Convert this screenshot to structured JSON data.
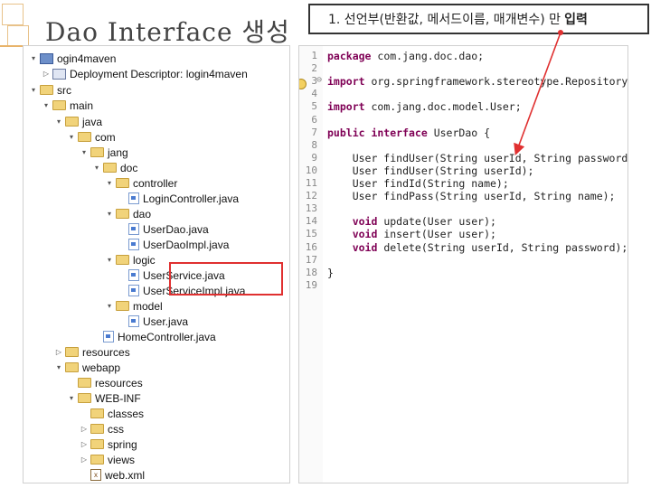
{
  "slide": {
    "title": "Dao Interface 생성",
    "callout_text": "1. 선언부(반환값, 메서드이름, 매개변수) 만",
    "callout_bold": "입력"
  },
  "tree": {
    "items": [
      {
        "label": "ogin4maven",
        "icon": "project-icon",
        "expand": "▾"
      },
      {
        "label": "Deployment Descriptor: login4maven",
        "icon": "descriptor-icon",
        "expand": "▷"
      },
      {
        "label": "src",
        "icon": "folder-icon",
        "expand": "▾"
      },
      {
        "label": "main",
        "icon": "folder-icon",
        "expand": "▾"
      },
      {
        "label": "java",
        "icon": "folder-icon",
        "expand": "▾"
      },
      {
        "label": "com",
        "icon": "folder-icon",
        "expand": "▾"
      },
      {
        "label": "jang",
        "icon": "folder-icon",
        "expand": "▾"
      },
      {
        "label": "doc",
        "icon": "folder-icon",
        "expand": "▾"
      },
      {
        "label": "controller",
        "icon": "folder-icon",
        "expand": "▾"
      },
      {
        "label": "LoginController.java",
        "icon": "java-file-icon",
        "expand": ""
      },
      {
        "label": "dao",
        "icon": "folder-icon",
        "expand": "▾"
      },
      {
        "label": "UserDao.java",
        "icon": "java-file-icon",
        "expand": ""
      },
      {
        "label": "UserDaoImpl.java",
        "icon": "java-file-icon",
        "expand": ""
      },
      {
        "label": "logic",
        "icon": "folder-icon",
        "expand": "▾"
      },
      {
        "label": "UserService.java",
        "icon": "java-file-icon",
        "expand": ""
      },
      {
        "label": "UserServiceImpl.java",
        "icon": "java-file-icon",
        "expand": ""
      },
      {
        "label": "model",
        "icon": "folder-icon",
        "expand": "▾"
      },
      {
        "label": "User.java",
        "icon": "java-file-icon",
        "expand": ""
      },
      {
        "label": "HomeController.java",
        "icon": "java-file-icon",
        "expand": ""
      },
      {
        "label": "resources",
        "icon": "folder-icon",
        "expand": "▷"
      },
      {
        "label": "webapp",
        "icon": "folder-icon",
        "expand": "▾"
      },
      {
        "label": "resources",
        "icon": "folder-icon",
        "expand": ""
      },
      {
        "label": "WEB-INF",
        "icon": "folder-icon",
        "expand": "▾"
      },
      {
        "label": "classes",
        "icon": "folder-icon",
        "expand": ""
      },
      {
        "label": "css",
        "icon": "folder-icon",
        "expand": "▷"
      },
      {
        "label": "spring",
        "icon": "folder-icon",
        "expand": "▷"
      },
      {
        "label": "views",
        "icon": "folder-icon",
        "expand": "▷"
      },
      {
        "label": "web.xml",
        "icon": "xml-file-icon",
        "expand": ""
      }
    ]
  },
  "code": {
    "line_numbers": [
      "1",
      "2",
      "3",
      "4",
      "5",
      "6",
      "7",
      "8",
      "9",
      "10",
      "11",
      "12",
      "13",
      "14",
      "15",
      "16",
      "17",
      "18",
      "19"
    ],
    "fold_marker": "⊖",
    "lines": [
      {
        "kw": "package",
        "rest": " com.jang.doc.dao;"
      },
      {
        "kw": "",
        "rest": ""
      },
      {
        "kw": "import",
        "rest": " org.springframework.stereotype.Repository;"
      },
      {
        "kw": "",
        "rest": ""
      },
      {
        "kw": "import",
        "rest": " com.jang.doc.model.User;"
      },
      {
        "kw": "",
        "rest": ""
      },
      {
        "kw": "public interface",
        "rest": " UserDao {"
      },
      {
        "kw": "",
        "rest": ""
      },
      {
        "kw": "",
        "rest": "    User findUser(String userId, String password);"
      },
      {
        "kw": "",
        "rest": "    User findUser(String userId);"
      },
      {
        "kw": "",
        "rest": "    User findId(String name);"
      },
      {
        "kw": "",
        "rest": "    User findPass(String userId, String name);"
      },
      {
        "kw": "",
        "rest": ""
      },
      {
        "kw": "    void",
        "rest": " update(User user);"
      },
      {
        "kw": "    void",
        "rest": " insert(User user);"
      },
      {
        "kw": "    void",
        "rest": " delete(String userId, String password);"
      },
      {
        "kw": "",
        "rest": ""
      },
      {
        "kw": "",
        "rest": "}"
      },
      {
        "kw": "",
        "rest": ""
      }
    ]
  },
  "colors": {
    "highlight": "#e03030",
    "arrow": "#e03030",
    "keyword": "#7f0055"
  }
}
